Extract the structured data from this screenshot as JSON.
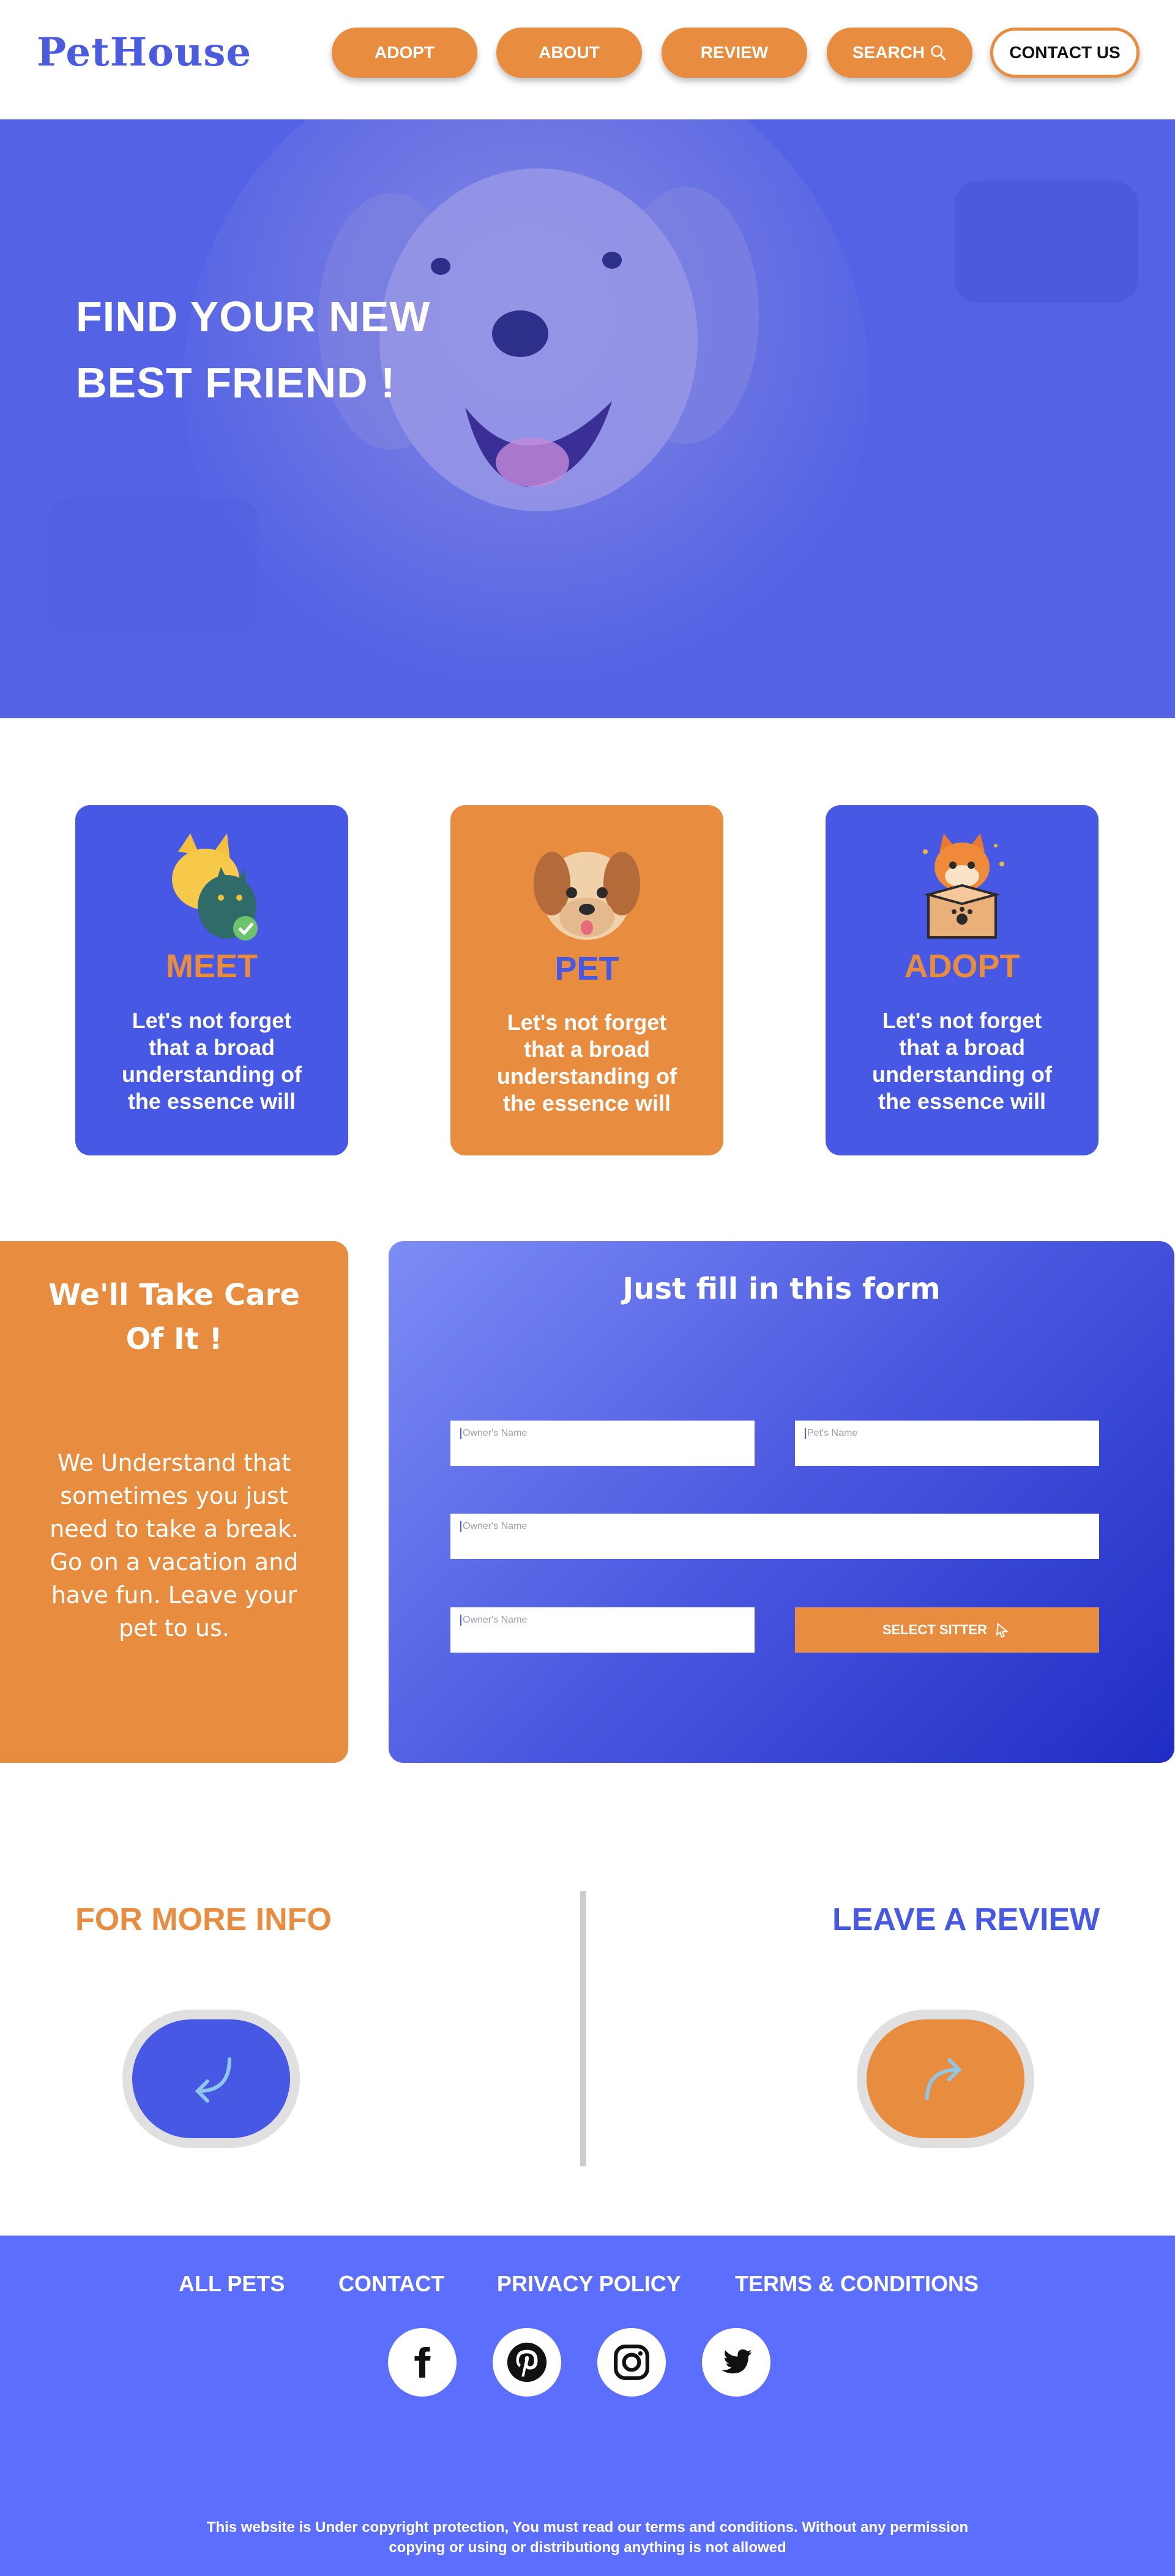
{
  "nav": {
    "logo": "PetHouse",
    "items": [
      {
        "label": "ADOPT"
      },
      {
        "label": "ABOUT"
      },
      {
        "label": "REVIEW"
      },
      {
        "label": "SEARCH"
      }
    ],
    "contact_label": "CONTACT US"
  },
  "hero": {
    "title_line1": "FIND YOUR NEW",
    "title_line2": "BEST FRIEND !"
  },
  "cards": [
    {
      "title": "MEET",
      "text": "Let's not forget that a broad understanding of the essence will",
      "icon": "cat-dog-check-icon"
    },
    {
      "title": "PET",
      "text": "Let's not forget that a broad understanding of the essence will",
      "icon": "dog-face-icon"
    },
    {
      "title": "ADOPT",
      "text": "Let's not forget that a broad understanding of the essence will",
      "icon": "cat-in-box-icon"
    }
  ],
  "care": {
    "title": "We'll Take Care Of It !",
    "text": "We Understand that sometimes you just need to take a break. Go on a vacation and have fun. Leave your pet to us."
  },
  "form": {
    "title": "Just fill in this form",
    "owner_placeholder": "Owner's Name",
    "pet_placeholder": "Pet's Name",
    "wide_placeholder": "Owner's Name",
    "third_placeholder": "Owner's Name",
    "button_label": "SELECT SITTER"
  },
  "info": {
    "left_title": "FOR MORE INFO",
    "right_title": "LEAVE A REVIEW"
  },
  "footer": {
    "links": [
      "ALL PETS",
      "CONTACT",
      "PRIVACY POLICY",
      "TERMS & CONDITIONS"
    ],
    "social": [
      "facebook-icon",
      "pinterest-icon",
      "instagram-icon",
      "twitter-icon"
    ],
    "copyright_line1": "This website is Under copyright protection, You must read our terms and conditions. Without any permission",
    "copyright_line2": "copying or using or distributiong anything is not allowed"
  },
  "colors": {
    "brand_blue": "#4a5be0",
    "brand_orange": "#e88d3f",
    "footer_blue": "#5c6efe"
  }
}
